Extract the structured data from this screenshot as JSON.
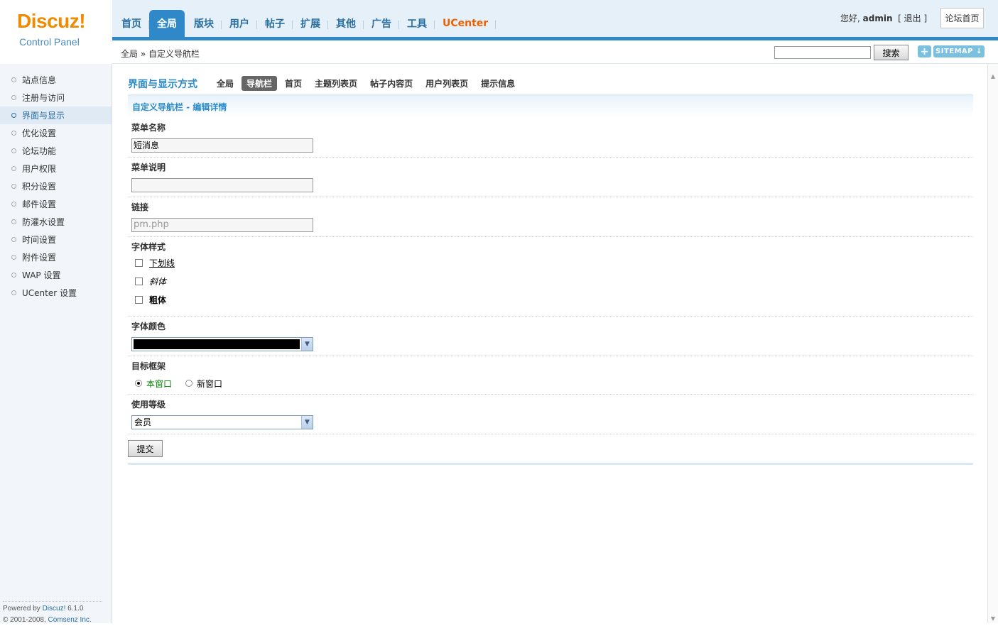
{
  "logo": {
    "main": "Discuz!",
    "sub": "Control Panel"
  },
  "topnav": {
    "tabs": [
      {
        "label": "首页"
      },
      {
        "label": "全局"
      },
      {
        "label": "版块"
      },
      {
        "label": "用户"
      },
      {
        "label": "帖子"
      },
      {
        "label": "扩展"
      },
      {
        "label": "其他"
      },
      {
        "label": "广告"
      },
      {
        "label": "工具"
      },
      {
        "label": "UCenter"
      }
    ],
    "active_index": 1
  },
  "userbar": {
    "greeting": "您好,",
    "user": "admin",
    "logout": "[ 退出 ]",
    "home": "论坛首页"
  },
  "breadcrumb": "全局 » 自定义导航栏",
  "search": {
    "button": "搜索",
    "plus": "+",
    "sitemap": "SITEMAP ↓"
  },
  "sidebar": {
    "items": [
      {
        "label": "站点信息"
      },
      {
        "label": "注册与访问"
      },
      {
        "label": "界面与显示"
      },
      {
        "label": "优化设置"
      },
      {
        "label": "论坛功能"
      },
      {
        "label": "用户权限"
      },
      {
        "label": "积分设置"
      },
      {
        "label": "邮件设置"
      },
      {
        "label": "防灌水设置"
      },
      {
        "label": "时间设置"
      },
      {
        "label": "附件设置"
      },
      {
        "label": "WAP 设置"
      },
      {
        "label": "UCenter 设置"
      }
    ],
    "active_index": 2,
    "footer_line1_a": "Powered by ",
    "footer_line1_link": "Discuz!",
    "footer_line1_b": " 6.1.0",
    "footer_line2_a": "© 2001-2008, ",
    "footer_line2_link": "Comsenz Inc."
  },
  "subnav": {
    "title": "界面与显示方式",
    "items": [
      {
        "label": "全局"
      },
      {
        "label": "导航栏"
      },
      {
        "label": "首页"
      },
      {
        "label": "主题列表页"
      },
      {
        "label": "帖子内容页"
      },
      {
        "label": "用户列表页"
      },
      {
        "label": "提示信息"
      }
    ],
    "active_index": 1
  },
  "form": {
    "header": "自定义导航栏 - 编辑详情",
    "name_label": "菜单名称",
    "name_value": "短消息",
    "desc_label": "菜单说明",
    "desc_value": "",
    "link_label": "链接",
    "link_value": "pm.php",
    "style_label": "字体样式",
    "style_options": {
      "underline": "下划线",
      "italic": "斜体",
      "bold": "粗体"
    },
    "color_label": "字体颜色",
    "color_value": "#000000",
    "target_label": "目标框架",
    "target_options": {
      "self": "本窗口",
      "blank": "新窗口"
    },
    "target_selected": "self",
    "level_label": "使用等级",
    "level_value": "会员",
    "submit": "提交"
  },
  "colors": {
    "accent": "#2f89c8",
    "brand": "#f08a00",
    "ucenter": "#f06000",
    "selected_radio": "#008000"
  }
}
